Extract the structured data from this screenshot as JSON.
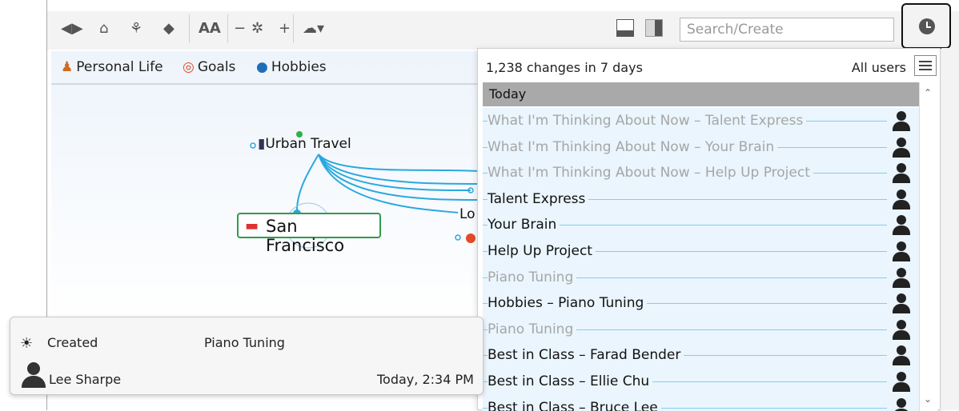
{
  "toolbar": {
    "icons": [
      "back-forward-icon",
      "home-icon",
      "tree-icon",
      "tag-icon",
      "font-size-icon",
      "minus-icon",
      "network-icon",
      "plus-icon",
      "cloud-icon"
    ],
    "font_size_label": "AA",
    "search_placeholder": "Search/Create"
  },
  "tabs": [
    {
      "label": "Personal Life",
      "icon": "person-icon"
    },
    {
      "label": "Goals",
      "icon": "target-icon"
    },
    {
      "label": "Hobbies",
      "icon": "pin-icon"
    }
  ],
  "map": {
    "parent_node": "Urban Travel",
    "active_node": "San Francisco",
    "partial_node": "Lo"
  },
  "history": {
    "summary": "1,238 changes in 7 days",
    "filter": "All users",
    "group": "Today",
    "items": [
      {
        "label": "What I'm Thinking About Now – Talent Express",
        "style": "faded"
      },
      {
        "label": "What I'm Thinking About Now – Your Brain",
        "style": "faded"
      },
      {
        "label": "What I'm Thinking About Now – Help Up Project",
        "style": "faded"
      },
      {
        "label": "Talent Express",
        "style": "dark"
      },
      {
        "label": "Your Brain",
        "style": "dark"
      },
      {
        "label": "Help Up Project",
        "style": "dark"
      },
      {
        "label": "Piano Tuning",
        "style": "faded"
      },
      {
        "label": "Hobbies – Piano Tuning",
        "style": "dark"
      },
      {
        "label": "Piano Tuning",
        "style": "faded"
      },
      {
        "label": "Best in Class – Farad Bender",
        "style": "dark"
      },
      {
        "label": "Best in Class – Ellie Chu",
        "style": "dark"
      },
      {
        "label": "Best in Class – Bruce Lee",
        "style": "dark"
      }
    ]
  },
  "tooltip": {
    "action": "Created",
    "thought": "Piano Tuning",
    "user": "Lee Sharpe",
    "time": "Today, 2:34 PM"
  },
  "colors": {
    "accent_line": "#7fd0ee",
    "selected_border": "#2e9d4b",
    "link_color": "#29a8e0"
  }
}
